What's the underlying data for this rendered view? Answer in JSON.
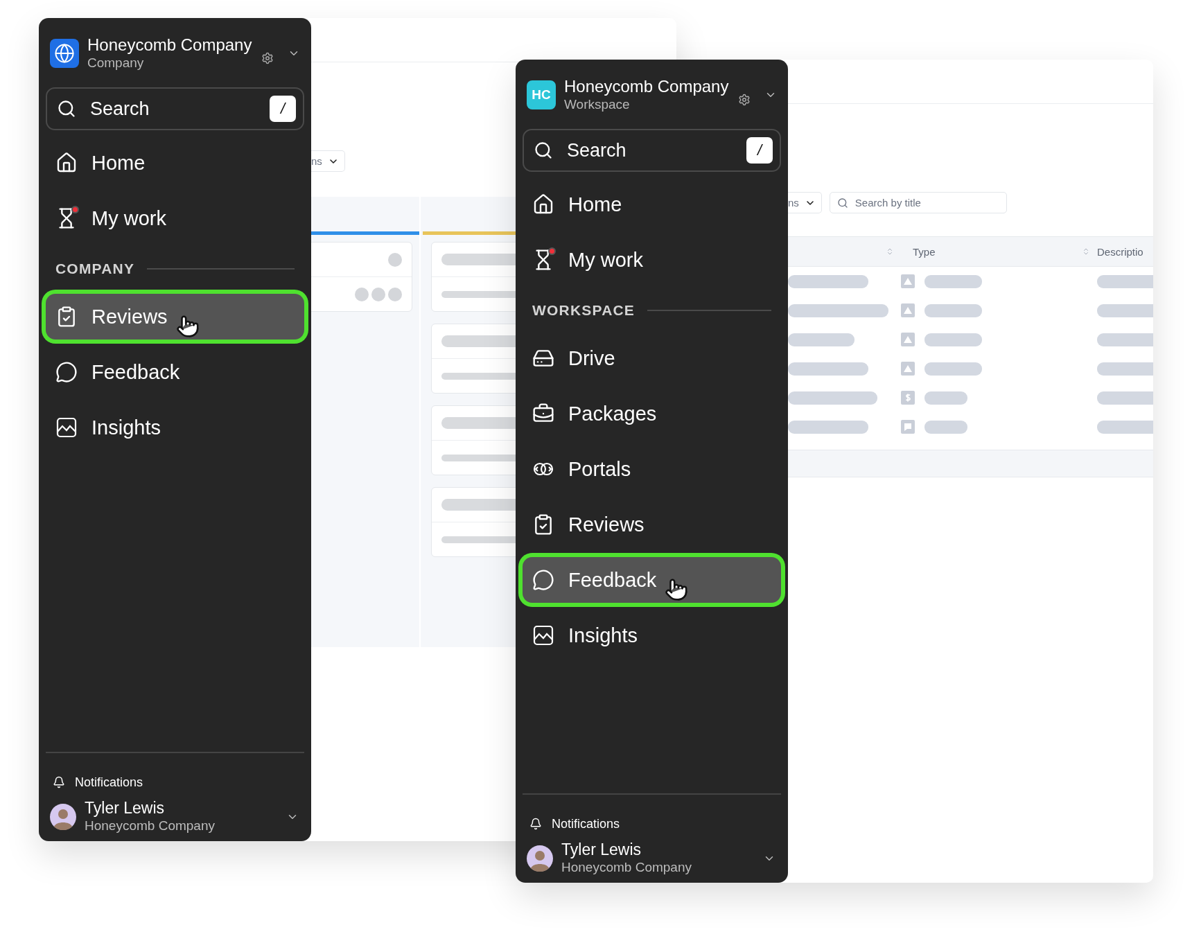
{
  "windows": [
    {
      "sidebar": {
        "workspace": {
          "name": "Honeycomb Company",
          "subtitle": "Company",
          "logo": {
            "kind": "globe"
          }
        },
        "search": {
          "placeholder": "Search",
          "shortcut": "/"
        },
        "nav": [
          {
            "label": "Home",
            "kind": "house",
            "badge": false,
            "selected": false
          },
          {
            "label": "My work",
            "kind": "hourglass",
            "badge": true,
            "selected": false
          }
        ],
        "section": {
          "title": "COMPANY",
          "items": [
            {
              "label": "Reviews",
              "kind": "clipboard",
              "selected": true
            },
            {
              "label": "Feedback",
              "kind": "bubble",
              "selected": false
            },
            {
              "label": "Insights",
              "kind": "chart",
              "selected": false
            }
          ]
        },
        "notifications": "Notifications",
        "user": {
          "name": "Tyler Lewis",
          "org": "Honeycomb Company"
        }
      },
      "page": {
        "kind": "board",
        "filter_label": "ns",
        "columns": [
          {
            "color": "#2f8fe8",
            "cards": [
              {
                "kind": "people"
              }
            ]
          },
          {
            "color": "#e8c45a",
            "cards": [
              {
                "kind": "lines"
              },
              {
                "kind": "lines"
              },
              {
                "kind": "lines"
              },
              {
                "kind": "lines"
              }
            ]
          }
        ]
      }
    },
    {
      "sidebar": {
        "workspace": {
          "name": "Honeycomb Company",
          "subtitle": "Workspace",
          "logo": {
            "kind": "initials",
            "text": "HC"
          }
        },
        "search": {
          "placeholder": "Search",
          "shortcut": "/"
        },
        "nav": [
          {
            "label": "Home",
            "kind": "house",
            "badge": false,
            "selected": false
          },
          {
            "label": "My work",
            "kind": "hourglass",
            "badge": true,
            "selected": false
          }
        ],
        "section": {
          "title": "WORKSPACE",
          "items": [
            {
              "label": "Drive",
              "kind": "drive",
              "selected": false
            },
            {
              "label": "Packages",
              "kind": "briefcase",
              "selected": false
            },
            {
              "label": "Portals",
              "kind": "portal",
              "selected": false
            },
            {
              "label": "Reviews",
              "kind": "clipboard",
              "selected": false
            },
            {
              "label": "Feedback",
              "kind": "bubble",
              "selected": true
            },
            {
              "label": "Insights",
              "kind": "chart",
              "selected": false
            }
          ]
        },
        "notifications": "Notifications",
        "user": {
          "name": "Tyler Lewis",
          "org": "Honeycomb Company"
        }
      },
      "page": {
        "kind": "table",
        "filter_label": "ns",
        "search_placeholder": "Search by title",
        "columns": [
          {
            "label": "Type"
          },
          {
            "label": "Descriptio"
          }
        ],
        "rows": [
          {
            "kind": "triangle"
          },
          {
            "kind": "triangle"
          },
          {
            "kind": "triangle"
          },
          {
            "kind": "triangle"
          },
          {
            "kind": "dollar"
          },
          {
            "kind": "comment"
          }
        ]
      }
    }
  ]
}
